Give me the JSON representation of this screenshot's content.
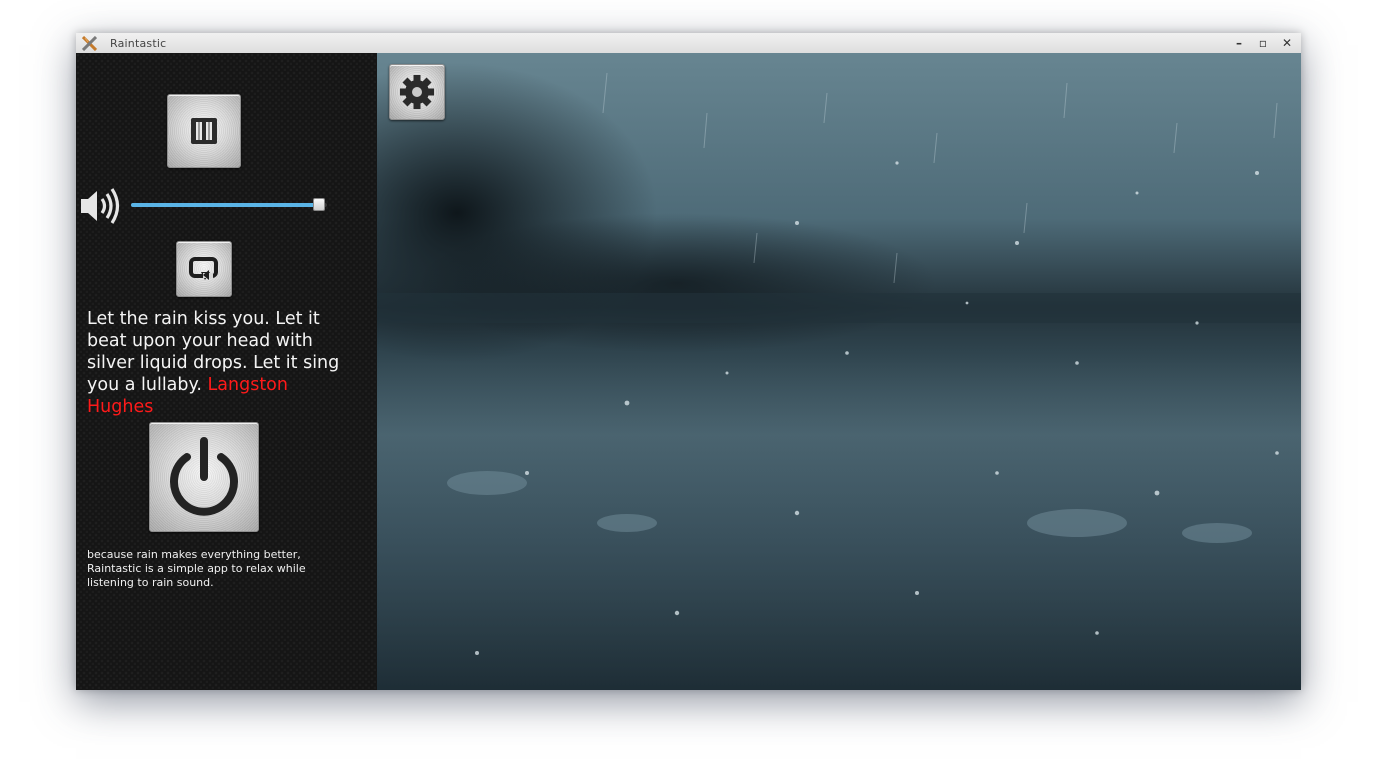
{
  "window": {
    "title": "Raintastic",
    "controls": {
      "minimize": "–",
      "maximize": "▫",
      "close": "✕"
    }
  },
  "player": {
    "pause_icon": "pause-icon",
    "repeat_icon": "repeat-icon",
    "power_icon": "power-icon",
    "settings_icon": "gear-icon",
    "volume_icon": "speaker-volume-icon",
    "volume_level": 0.96,
    "accent_color": "#5ab4e6"
  },
  "quote": {
    "text": "Let the rain kiss you. Let it beat upon your head with silver liquid drops. Let it sing you a lullaby.",
    "author": "Langston Hughes",
    "author_color": "#ff1a1a"
  },
  "about": {
    "text": "because rain makes everything better, Raintastic is a simple app to relax while listening to rain sound."
  }
}
